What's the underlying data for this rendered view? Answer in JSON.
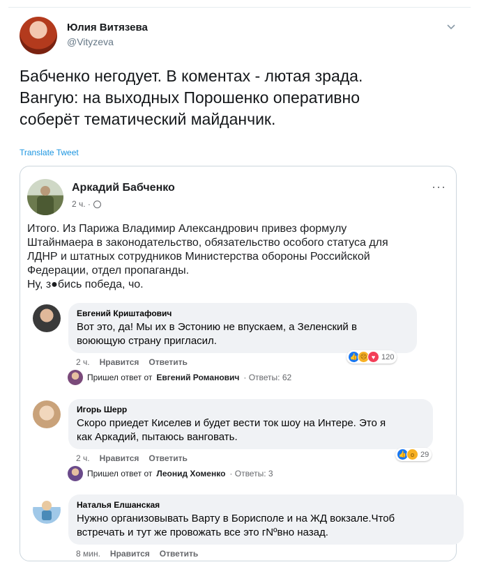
{
  "tweet": {
    "author_name": "Юлия Витязева",
    "author_handle": "@Vityzeva",
    "text_lines": [
      "Бабченко негодует. В коментах - лютая зрада.",
      "Вангую: на выходных Порошенко оперативно",
      "соберёт тематический майданчик."
    ],
    "translate_label": "Translate Tweet",
    "menu_icon": "chevron-down-icon"
  },
  "fb_post": {
    "author_name": "Аркадий Бабченко",
    "meta_time": "2 ч. ·",
    "audience_icon": "globe-icon",
    "more_icon": "more-dots-icon",
    "more_label": "···",
    "text_lines": [
      "Итого. Из Парижа Владимир Александрович привез формулу",
      "Штайнмаера в законодательство, обязательство особого статуса для",
      "ЛДНР и штатных сотрудников Министерства обороны Российской",
      "Федерации, отдел пропаганды.",
      "Ну, з●бись победа, чо."
    ]
  },
  "comments": [
    {
      "name": "Евгений Криштафович",
      "lines": [
        "Вот это, да! Мы их в Эстонию не впускаем, а Зеленский в",
        "воюющую страну пригласил."
      ],
      "time": "2 ч.",
      "like_label": "Нравится",
      "reply_label": "Ответить",
      "reaction_count": "120",
      "reply_summary": {
        "prefix": "Пришел ответ от",
        "name": "Евгений Романович",
        "suffix": "· Ответы: 62"
      }
    },
    {
      "name": "Игорь Шерр",
      "lines": [
        "Скоро приедет Киселев и будет вести ток шоу на Интере. Это я",
        "как Аркадий, пытаюсь ванговать."
      ],
      "time": "2 ч.",
      "like_label": "Нравится",
      "reply_label": "Ответить",
      "reaction_count": "29",
      "reply_summary": {
        "prefix": "Пришел ответ от",
        "name": "Леонид Хоменко",
        "suffix": "· Ответы: 3"
      }
    },
    {
      "name": "Наталья Елшанская",
      "lines": [
        "Нужно организовывать Варту в Борисполе и на ЖД вокзале.Чтоб",
        "встречать и тут же провожать все это гNºвно назад."
      ],
      "time": "8 мин.",
      "like_label": "Нравится",
      "reply_label": "Ответить"
    }
  ],
  "colors": {
    "link": "#1b95e0",
    "bubble": "#f0f2f5",
    "like": "#1877f2",
    "love": "#f33e58",
    "sad": "#f7b125"
  }
}
